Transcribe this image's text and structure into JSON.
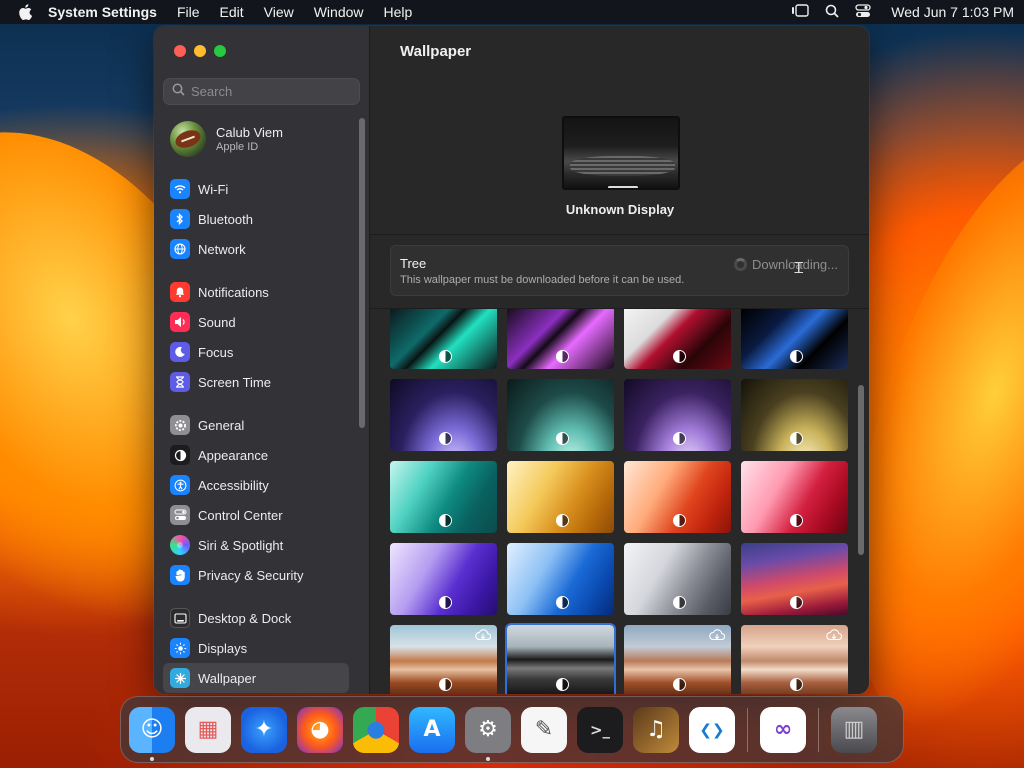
{
  "menubar": {
    "app_name": "System Settings",
    "menus": [
      "File",
      "Edit",
      "View",
      "Window",
      "Help"
    ],
    "clock": "Wed Jun 7  1:03 PM"
  },
  "sidebar": {
    "search_placeholder": "Search",
    "account": {
      "name": "Calub Viem",
      "subtitle": "Apple ID"
    },
    "groups": [
      [
        {
          "label": "Wi-Fi",
          "icon": "wifi-icon",
          "color": "#1a84ff",
          "glyph": "◠"
        },
        {
          "label": "Bluetooth",
          "icon": "bluetooth-icon",
          "color": "#1a84ff",
          "glyph": "ᛒ"
        },
        {
          "label": "Network",
          "icon": "globe-icon",
          "color": "#1a84ff",
          "glyph": "◍"
        }
      ],
      [
        {
          "label": "Notifications",
          "icon": "bell-icon",
          "color": "#ff3b30",
          "glyph": "▲"
        },
        {
          "label": "Sound",
          "icon": "speaker-icon",
          "color": "#ff2d55",
          "glyph": "◀"
        },
        {
          "label": "Focus",
          "icon": "moon-icon",
          "color": "#5e5ce6",
          "glyph": "☾"
        },
        {
          "label": "Screen Time",
          "icon": "hourglass-icon",
          "color": "#5e5ce6",
          "glyph": "⧗"
        }
      ],
      [
        {
          "label": "General",
          "icon": "gear-icon",
          "color": "#8e8e93",
          "glyph": "⚙"
        },
        {
          "label": "Appearance",
          "icon": "appearance-icon",
          "color": "#1c1c1e",
          "glyph": "◐"
        },
        {
          "label": "Accessibility",
          "icon": "accessibility-icon",
          "color": "#1a84ff",
          "glyph": "♿"
        },
        {
          "label": "Control Center",
          "icon": "toggles-icon",
          "color": "#8e8e93",
          "glyph": "☰"
        },
        {
          "label": "Siri & Spotlight",
          "icon": "siri-icon",
          "color": "#b14bd6",
          "glyph": "◉"
        },
        {
          "label": "Privacy & Security",
          "icon": "hand-icon",
          "color": "#1a84ff",
          "glyph": "✋"
        }
      ],
      [
        {
          "label": "Desktop & Dock",
          "icon": "dock-icon",
          "color": "#2c2c2e",
          "glyph": "▭"
        },
        {
          "label": "Displays",
          "icon": "sun-icon",
          "color": "#1a84ff",
          "glyph": "☀"
        },
        {
          "label": "Wallpaper",
          "icon": "wallpaper-icon",
          "color": "#33aadd",
          "glyph": "✺",
          "selected": true
        }
      ]
    ]
  },
  "main": {
    "title": "Wallpaper",
    "display_name": "Unknown Display",
    "selected_wallpaper": {
      "name": "Tree",
      "description": "This wallpaper must be downloaded before it can be used.",
      "status": "Downloading..."
    }
  },
  "wallpapers": [
    {
      "name": "green-spectrum",
      "bg": "linear-gradient(135deg,#0d1a1e 0%,#0f6b6a 35%,#0a1414 45%,#22e0c0 60%,#0b1a1c 100%)",
      "dynamic": true
    },
    {
      "name": "purple-spectrum",
      "bg": "linear-gradient(135deg,#1a0d1e 0%,#8a2fbf 35%,#140a16 45%,#e66bff 60%,#1a0b1c 100%)",
      "dynamic": true
    },
    {
      "name": "red-fold",
      "bg": "linear-gradient(135deg,#f3f3f3 0%,#dcdcdc 30%,#b01030 45%,#2a0508 70%,#6a0a14 100%)",
      "dynamic": true
    },
    {
      "name": "blue-fold",
      "bg": "linear-gradient(135deg,#000 0%,#0a1a40 30%,#2a6bd6 50%,#000 70%,#1a2c5a 100%)",
      "dynamic": true
    },
    {
      "name": "sonoma-violet",
      "bg": "radial-gradient(ellipse at 60% 120%,#d9d0ff 0%,#7b6bd8 30%,#2b2060 60%,#0e0a24 100%)",
      "dynamic": true
    },
    {
      "name": "sonoma-teal",
      "bg": "radial-gradient(ellipse at 60% 120%,#d0fff4 0%,#5fbcb0 30%,#1d4a48 60%,#0a1a1a 100%)",
      "dynamic": true
    },
    {
      "name": "sonoma-lavender",
      "bg": "radial-gradient(ellipse at 60% 120%,#f0e0ff 0%,#a07ad8 30%,#3a2260 60%,#120a24 100%)",
      "dynamic": true
    },
    {
      "name": "sonoma-gold",
      "bg": "radial-gradient(ellipse at 60% 120%,#fff6cc 0%,#c9b25a 30%,#4a4020 60%,#141208 100%)",
      "dynamic": true
    },
    {
      "name": "imac-green",
      "bg": "linear-gradient(120deg,#c6f5ee 0%,#4fd2c2 30%,#0e8a80 55%,#096260 75%,#0a4c4c 100%)",
      "dynamic": true
    },
    {
      "name": "imac-yellow",
      "bg": "linear-gradient(120deg,#fff3c4 0%,#f4c95a 35%,#d9901e 60%,#b86a0a 80%,#8a4a08 100%)",
      "dynamic": true
    },
    {
      "name": "imac-orange",
      "bg": "linear-gradient(120deg,#ffe7d6 0%,#ffab7a 35%,#e0451e 60%,#c0240e 80%,#8a1408 100%)",
      "dynamic": true
    },
    {
      "name": "imac-pink",
      "bg": "linear-gradient(120deg,#ffe2ea 0%,#ff9ab0 35%,#d32040 60%,#a80a22 80%,#6a0414 100%)",
      "dynamic": true
    },
    {
      "name": "imac-purple",
      "bg": "linear-gradient(120deg,#efe6ff 0%,#b49cf0 35%,#5a2fd0 60%,#3d18a8 80%,#260e70 100%)",
      "dynamic": true
    },
    {
      "name": "imac-blue",
      "bg": "linear-gradient(120deg,#e2f0ff 0%,#8cc0f4 35%,#1a6ad6 60%,#0a4ab0 80%,#062a78 100%)",
      "dynamic": true
    },
    {
      "name": "imac-silver",
      "bg": "linear-gradient(120deg,#f4f4f6 0%,#d4d6dc 35%,#8a8d96 60%,#5a5d66 80%,#3a3c44 100%)",
      "dynamic": true
    },
    {
      "name": "big-sur",
      "bg": "linear-gradient(170deg,#3b3f8a 0%,#6a4ba8 25%,#d04a6a 50%,#e8604a 65%,#9a1a3a 85%,#4a0a2a 100%)",
      "dynamic": true
    },
    {
      "name": "monterey-rocks",
      "bg": "linear-gradient(180deg,#9fc4d8 0%,#d8e2e6 30%,#c27a4a 50%,#e6c0a0 62%,#9a4a22 80%,#5a2a14 100%)",
      "dynamic": true,
      "cloud": true
    },
    {
      "name": "tree",
      "bg": "linear-gradient(180deg,#cfd8de 0%,#a8b4ba 30%,#1a1a1a 48%,#7a7a7a 60%,#3a3a3a 75%,#111 100%)",
      "dynamic": true,
      "selected": true
    },
    {
      "name": "valley",
      "bg": "linear-gradient(180deg,#8fa7c0 0%,#c2ccd6 30%,#b87a5a 50%,#e8c4a8 62%,#a0502a 80%,#5a2a14 100%)",
      "dynamic": true,
      "cloud": true
    },
    {
      "name": "dome",
      "bg": "linear-gradient(180deg,#d6a48a 0%,#f0d0bc 30%,#c08a6a 50%,#f2dcc8 62%,#a86040 80%,#6a3418 100%)",
      "dynamic": true,
      "cloud": true
    }
  ],
  "dock": [
    {
      "name": "finder",
      "icon": "finder-icon",
      "bg": "linear-gradient(90deg,#5ab4ff 50%,#1c7ef0 50%)",
      "glyph": "☺",
      "running": true
    },
    {
      "name": "launchpad",
      "icon": "launchpad-icon",
      "bg": "#e9e9ee",
      "glyph": "▦",
      "color": "#e65a5a"
    },
    {
      "name": "safari",
      "icon": "safari-icon",
      "bg": "radial-gradient(circle,#3aa0ff 0%,#1a62e0 70%)",
      "glyph": "✦"
    },
    {
      "name": "firefox",
      "icon": "firefox-icon",
      "bg": "radial-gradient(circle,#ffb020 0%,#ff5a1a 50%,#7a2fd0 100%)",
      "glyph": "◕"
    },
    {
      "name": "chrome",
      "icon": "chrome-icon",
      "bg": "conic-gradient(#ea4335 0 120deg,#fbbc05 0 240deg,#34a853 0)",
      "glyph": "●",
      "color": "#2a7de1"
    },
    {
      "name": "app-store",
      "icon": "app-store-icon",
      "bg": "linear-gradient(180deg,#30b8ff,#1a6ef0)",
      "glyph": "A"
    },
    {
      "name": "system-settings",
      "icon": "settings-gear-icon",
      "bg": "#7d7d82",
      "glyph": "⚙",
      "running": true
    },
    {
      "name": "textedit",
      "icon": "textedit-icon",
      "bg": "#f6f6f6",
      "glyph": "✎",
      "color": "#555"
    },
    {
      "name": "terminal",
      "icon": "terminal-icon",
      "bg": "#1c1c1e",
      "glyph": ">_",
      "color": "#ddd"
    },
    {
      "name": "instruments",
      "icon": "instruments-icon",
      "bg": "linear-gradient(135deg,#5a3a1a,#c08a3a)",
      "glyph": "♫"
    },
    {
      "name": "vscode",
      "icon": "vscode-icon",
      "bg": "#ffffff",
      "glyph": "❮❯",
      "color": "#1a7ad4"
    },
    {
      "name": "visual-studio",
      "icon": "visual-studio-icon",
      "bg": "#ffffff",
      "glyph": "∞",
      "color": "#7a3fd0"
    },
    {
      "name": "trash",
      "icon": "trash-icon",
      "bg": "linear-gradient(180deg,#8a8a8e,#4a4a4e)",
      "glyph": "▥",
      "color": "#ccc"
    }
  ]
}
